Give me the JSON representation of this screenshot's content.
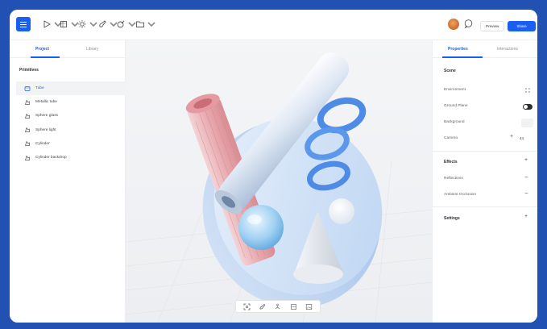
{
  "toolbar": {
    "preview_label": "Preview",
    "share_label": "Share"
  },
  "left_panel": {
    "tabs": [
      {
        "label": "Project",
        "active": true
      },
      {
        "label": "Library",
        "active": false
      }
    ],
    "section_title": "Primitives",
    "items": [
      {
        "label": "Tube",
        "selected": true
      },
      {
        "label": "Metallic tube",
        "selected": false
      },
      {
        "label": "Sphere glass",
        "selected": false
      },
      {
        "label": "Sphere light",
        "selected": false
      },
      {
        "label": "Cylinder",
        "selected": false
      },
      {
        "label": "Cylinder backdrop",
        "selected": false
      }
    ]
  },
  "right_panel": {
    "tabs": [
      {
        "label": "Properties",
        "active": true
      },
      {
        "label": "Interactions",
        "active": false
      }
    ],
    "scene": {
      "title": "Scene",
      "environment": "Environment",
      "ground_plane": "Ground Plane",
      "background": "Background",
      "camera": "Camera",
      "camera_value": "44"
    },
    "effects": {
      "title": "Effects",
      "reflections": "Reflections",
      "ambient_occlusion": "Ambient Occlusion"
    },
    "settings": {
      "title": "Settings"
    }
  },
  "colors": {
    "accent": "#1a5ff0",
    "outer_background": "#2251b4"
  },
  "icons": {
    "menu": "menu-icon",
    "play": "play-icon",
    "cube": "cube-icon",
    "light": "light-icon",
    "brush": "brush-icon",
    "pen": "pen-icon",
    "folder": "folder-icon",
    "chat": "chat-icon"
  }
}
